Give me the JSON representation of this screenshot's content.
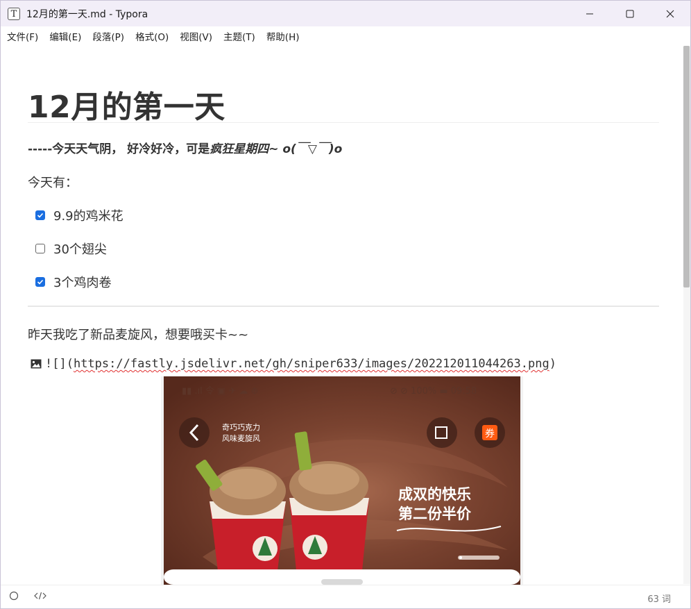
{
  "window": {
    "title": "12月的第一天.md - Typora",
    "app_icon_letter": "T"
  },
  "menu": [
    "文件(F)",
    "编辑(E)",
    "段落(P)",
    "格式(O)",
    "视图(V)",
    "主题(T)",
    "帮助(H)"
  ],
  "doc": {
    "heading": "12月的第一天",
    "subtitle_plain": "-----今天天气阴， 好冷好冷，可是",
    "subtitle_italic": "疯狂星期四~ o(￣▽￣)o",
    "intro": "今天有：",
    "tasks": [
      {
        "label": "9.9的鸡米花",
        "checked": true
      },
      {
        "label": "30个翅尖",
        "checked": false
      },
      {
        "label": "3个鸡肉卷",
        "checked": true
      }
    ],
    "para2": "昨天我吃了新品麦旋风，想要哦买卡~~",
    "image_md_prefix": "![](",
    "image_url": "https://fastly.jsdelivr.net/gh/sniper633/images/202212011044263.png",
    "image_md_suffix": ")"
  },
  "photo": {
    "status_left": "▮▮ .ıl 令 ▣ ✈ ☁ ⊕",
    "status_right": "⊘ ⊘ 100% ▬ 09:58",
    "brand_line1": "奇巧巧克力",
    "brand_line2": "风味麦旋风",
    "coupon": "券",
    "promo_line1": "成双的快乐",
    "promo_line2": "第二份半价"
  },
  "status": {
    "word_count": "63 词"
  },
  "colors": {
    "checkbox": "#1a6ee0",
    "title_bar": "#f2eef8",
    "spellcheck": "#e03131"
  }
}
